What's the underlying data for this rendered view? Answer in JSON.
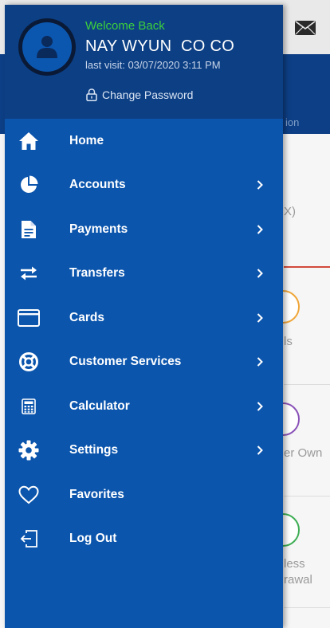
{
  "background_app": {
    "banner_fragment": "ion",
    "fragment_top": "X)",
    "fragment_1": "ls",
    "fragment_2": "er Own",
    "fragment_3": "less",
    "fragment_4": "rawal"
  },
  "profile": {
    "welcome": "Welcome Back",
    "name": "NAY WYUN  CO CO",
    "last_visit": "last visit: 03/07/2020 3:11 PM",
    "change_password": "Change Password"
  },
  "menu": {
    "items": [
      {
        "label": "Home",
        "icon": "home-icon",
        "has_chevron": false
      },
      {
        "label": "Accounts",
        "icon": "pie-chart-icon",
        "has_chevron": true
      },
      {
        "label": "Payments",
        "icon": "document-icon",
        "has_chevron": true
      },
      {
        "label": "Transfers",
        "icon": "transfer-arrows-icon",
        "has_chevron": true
      },
      {
        "label": "Cards",
        "icon": "card-icon",
        "has_chevron": true
      },
      {
        "label": "Customer Services",
        "icon": "lifebuoy-icon",
        "has_chevron": true
      },
      {
        "label": "Calculator",
        "icon": "calculator-icon",
        "has_chevron": true
      },
      {
        "label": "Settings",
        "icon": "gear-icon",
        "has_chevron": true
      },
      {
        "label": "Favorites",
        "icon": "heart-icon",
        "has_chevron": false
      },
      {
        "label": "Log Out",
        "icon": "logout-icon",
        "has_chevron": false
      }
    ]
  },
  "colors": {
    "drawer": "#0b55ad",
    "header": "#0c3f84",
    "welcome": "#3ccf3c",
    "text": "#ffffff"
  }
}
